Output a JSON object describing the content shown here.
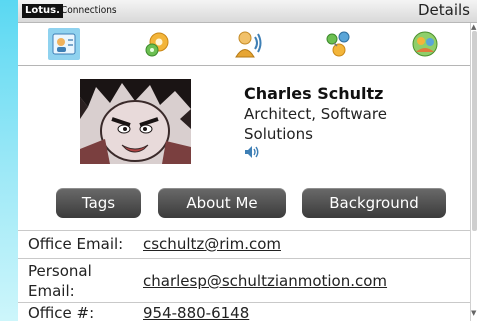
{
  "titlebar": {
    "brand": "Lotus.",
    "app_name": "Connections",
    "screen_title": "Details"
  },
  "tabs": [
    {
      "icon": "profile-card-icon",
      "selected": true
    },
    {
      "icon": "activities-gear-icon",
      "selected": false
    },
    {
      "icon": "person-audio-icon",
      "selected": false
    },
    {
      "icon": "network-people-icon",
      "selected": false
    },
    {
      "icon": "communities-icon",
      "selected": false
    }
  ],
  "profile": {
    "name": "Charles Schultz",
    "role": "Architect, Software Solutions",
    "pronunciation_icon": "speaker-icon"
  },
  "buttons": {
    "tags": "Tags",
    "about_me": "About Me",
    "background": "Background"
  },
  "contact": {
    "office_email_label": "Office Email:",
    "office_email": "cschultz@rim.com",
    "personal_email_label_line1": "Personal",
    "personal_email_label_line2": "Email:",
    "personal_email": "charlesp@schultzianmotion.com",
    "office_phone_label": "Office #:",
    "office_phone": "954-880-6148"
  },
  "colors": {
    "background_gradient_top": "#5ad8f2",
    "selected_tab": "#8fd2ef",
    "button": "#4a4a4a"
  }
}
